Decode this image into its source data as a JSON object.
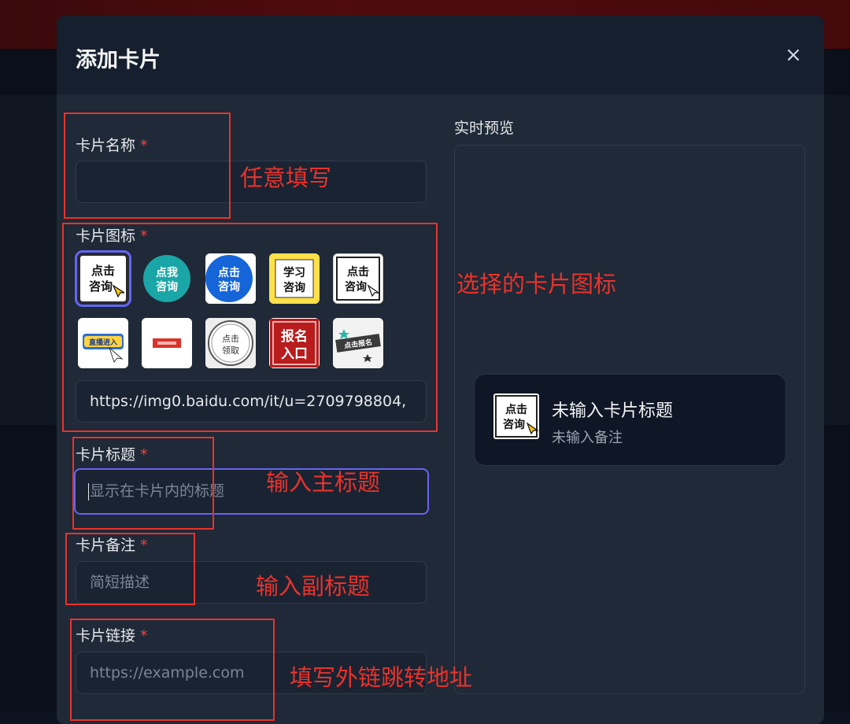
{
  "modal": {
    "title": "添加卡片",
    "close_label": "×"
  },
  "form": {
    "name": {
      "label": "卡片名称",
      "required": "*",
      "value": ""
    },
    "icon": {
      "label": "卡片图标",
      "required": "*",
      "url_value": "https://img0.baidu.com/it/u=2709798804,",
      "options": [
        {
          "name": "点击咨询-黑白",
          "text": "点击咨询",
          "selected": true
        },
        {
          "name": "点我咨询-青色圆",
          "text": "点我咨询"
        },
        {
          "name": "点击咨询-蓝色气泡",
          "text": "点击咨询"
        },
        {
          "name": "学习咨询-黄色",
          "text": "学习咨询"
        },
        {
          "name": "点击咨询-手指",
          "text": "点击咨询"
        },
        {
          "name": "直播进入",
          "text": "直播进入"
        },
        {
          "name": "红色横幅",
          "text": ""
        },
        {
          "name": "点击领取",
          "text": "点击领取"
        },
        {
          "name": "报名入口",
          "text": "报名入口"
        },
        {
          "name": "点击报名",
          "text": "点击报名"
        }
      ]
    },
    "title": {
      "label": "卡片标题",
      "required": "*",
      "placeholder": "显示在卡片内的标题"
    },
    "note": {
      "label": "卡片备注",
      "required": "*",
      "placeholder": "简短描述"
    },
    "link": {
      "label": "卡片链接",
      "required": "*",
      "placeholder": "https://example.com"
    }
  },
  "preview": {
    "label": "实时预览",
    "card_title": "未输入卡片标题",
    "card_subtitle": "未输入备注",
    "card_icon_text": "点击咨询"
  },
  "annotations": {
    "name": "任意填写",
    "icon": "选择的卡片图标",
    "title": "输入主标题",
    "note": "输入副标题",
    "link": "填写外链跳转地址"
  },
  "colors": {
    "accent": "#6366f1",
    "annotation": "#e8332b",
    "required": "#ef4444",
    "modal_bg": "#1f2937",
    "header_bg": "#161f2e"
  }
}
